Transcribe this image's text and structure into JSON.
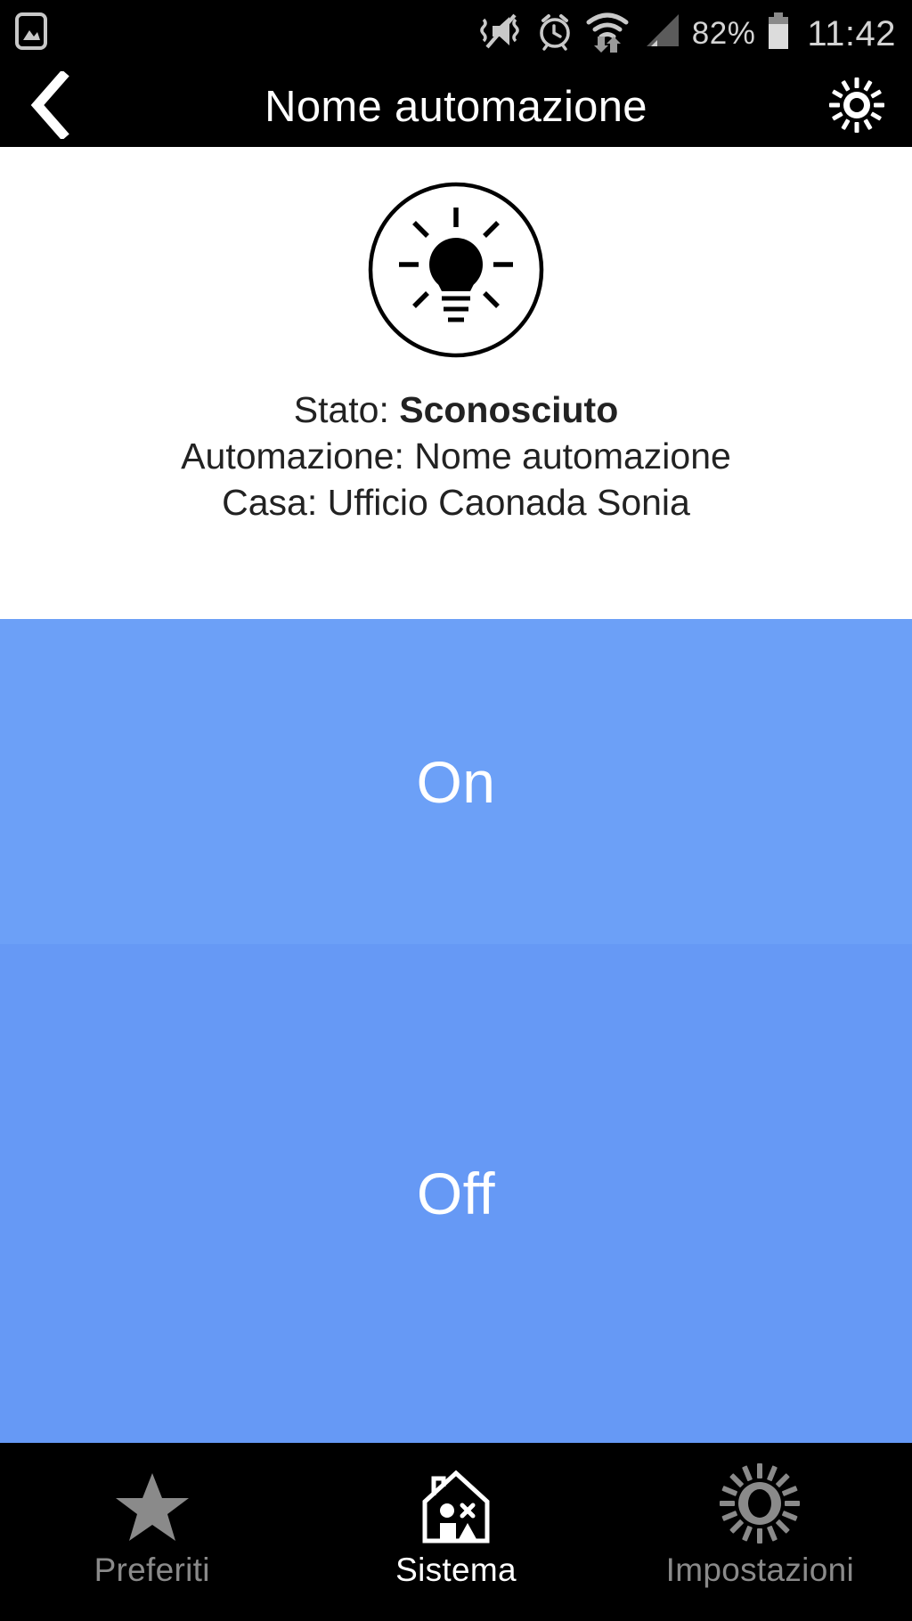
{
  "status_bar": {
    "notification_icon": "image-icon",
    "icons": [
      "mute-vibrate-icon",
      "alarm-icon",
      "wifi-data-icon",
      "cellular-signal-icon"
    ],
    "battery_percent": "82%",
    "battery_icon": "battery-icon",
    "clock": "11:42"
  },
  "header": {
    "back_icon": "back-chevron-icon",
    "title": "Nome automazione",
    "settings_icon": "gear-icon"
  },
  "info": {
    "device_icon": "lightbulb-icon",
    "lines": [
      {
        "label": "Stato: ",
        "value": "Sconosciuto",
        "bold": true
      },
      {
        "label": "Automazione: ",
        "value": "Nome automazione",
        "bold": false
      },
      {
        "label": "Casa: ",
        "value": "Ufficio Caonada Sonia",
        "bold": false
      }
    ],
    "state_label": "Stato: ",
    "state_value": "Sconosciuto",
    "automation_label": "Automazione: ",
    "automation_value": "Nome automazione",
    "home_label": "Casa: ",
    "home_value": "Ufficio Caonada Sonia"
  },
  "actions": {
    "on_label": "On",
    "off_label": "Off",
    "on_color": "#6ca0f7",
    "off_color": "#6699f5"
  },
  "bottom_nav": {
    "items": [
      {
        "label": "Preferiti",
        "icon": "star-icon",
        "active": false
      },
      {
        "label": "Sistema",
        "icon": "house-icon",
        "active": true
      },
      {
        "label": "Impostazioni",
        "icon": "gear-icon",
        "active": false
      }
    ]
  },
  "colors": {
    "bar_background": "#000000",
    "content_background": "#ffffff",
    "status_text": "#d4d4d4",
    "inactive_nav": "#8a8a8a",
    "active_nav": "#ffffff",
    "body_text": "#222222"
  }
}
